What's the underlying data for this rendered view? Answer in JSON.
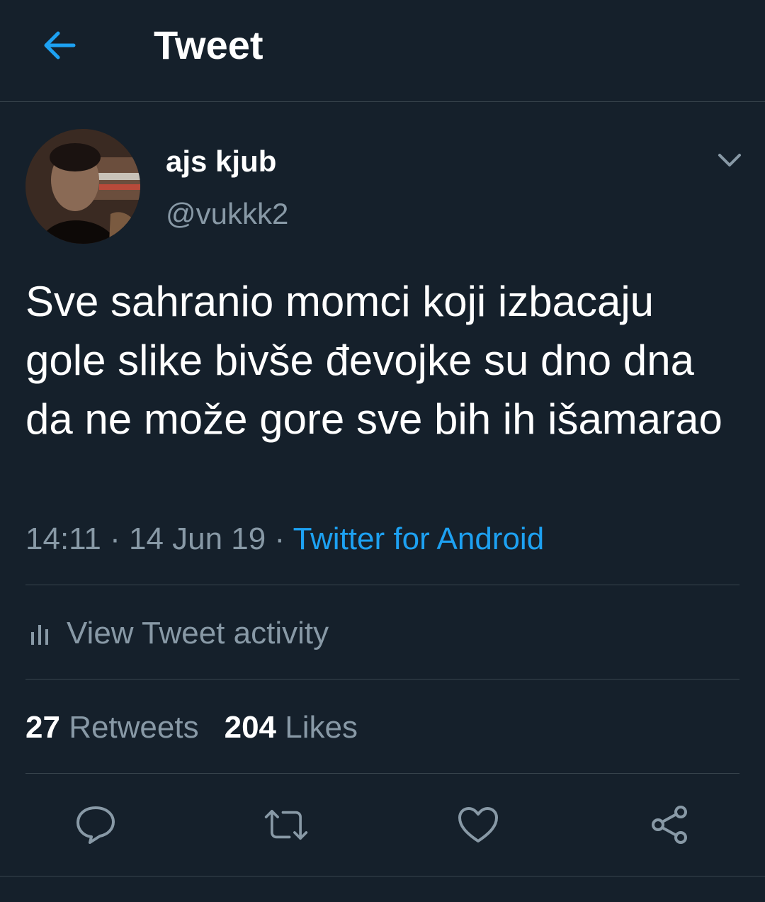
{
  "header": {
    "title": "Tweet",
    "back_icon": "arrow-left-icon"
  },
  "author": {
    "display_name": "ajs kjub",
    "handle": "@vukkk2"
  },
  "tweet": {
    "text": "Sve sahranio momci koji izbacaju gole slike bivše đevojke su dno dna da ne može gore sve bih ih išamarao",
    "time": "14:11",
    "separator": "·",
    "date": "14 Jun 19",
    "source": "Twitter for Android"
  },
  "activity": {
    "label": "View Tweet activity"
  },
  "stats": {
    "retweets_count": "27",
    "retweets_label": "Retweets",
    "likes_count": "204",
    "likes_label": "Likes"
  },
  "actions": [
    "reply-icon",
    "retweet-icon",
    "like-icon",
    "share-icon"
  ],
  "colors": {
    "background": "#15202b",
    "accent": "#1da1f2",
    "secondary_text": "#8899a6",
    "divider": "#38444d"
  }
}
